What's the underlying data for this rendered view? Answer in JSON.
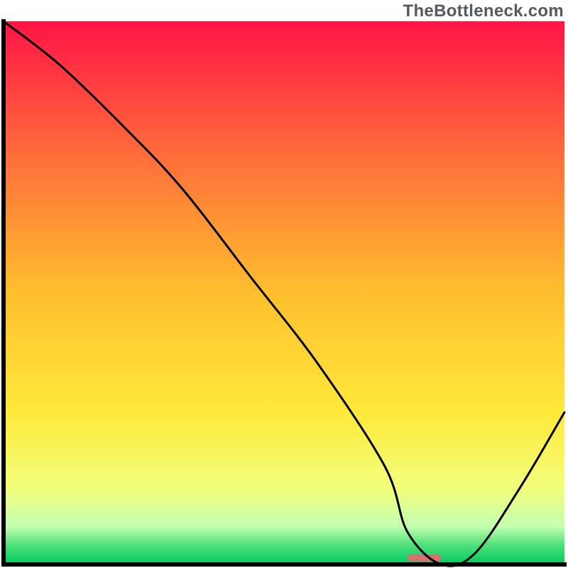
{
  "watermark": "TheBottleneck.com",
  "chart_data": {
    "type": "line",
    "title": "",
    "xlabel": "",
    "ylabel": "",
    "xlim": [
      0,
      100
    ],
    "ylim": [
      0,
      100
    ],
    "grid": false,
    "legend": false,
    "marker": {
      "x": 75,
      "width": 6,
      "color": "#d9706f"
    },
    "series": [
      {
        "name": "curve",
        "color": "#000000",
        "x": [
          0,
          10,
          22,
          32,
          44,
          56,
          68,
          72,
          78,
          84,
          92,
          100
        ],
        "y": [
          100,
          92,
          80,
          69,
          53,
          37,
          18,
          6,
          0,
          2,
          14,
          28
        ]
      }
    ],
    "background_gradient": {
      "stops": [
        {
          "offset": 0.0,
          "color": "#ff1446"
        },
        {
          "offset": 0.25,
          "color": "#ff6e3b"
        },
        {
          "offset": 0.5,
          "color": "#ffbf2e"
        },
        {
          "offset": 0.72,
          "color": "#ffe93a"
        },
        {
          "offset": 0.86,
          "color": "#f3ff7c"
        },
        {
          "offset": 0.93,
          "color": "#c4ffb0"
        },
        {
          "offset": 0.965,
          "color": "#4de07a"
        },
        {
          "offset": 1.0,
          "color": "#00c85f"
        }
      ]
    },
    "axis_thickness": 6
  }
}
